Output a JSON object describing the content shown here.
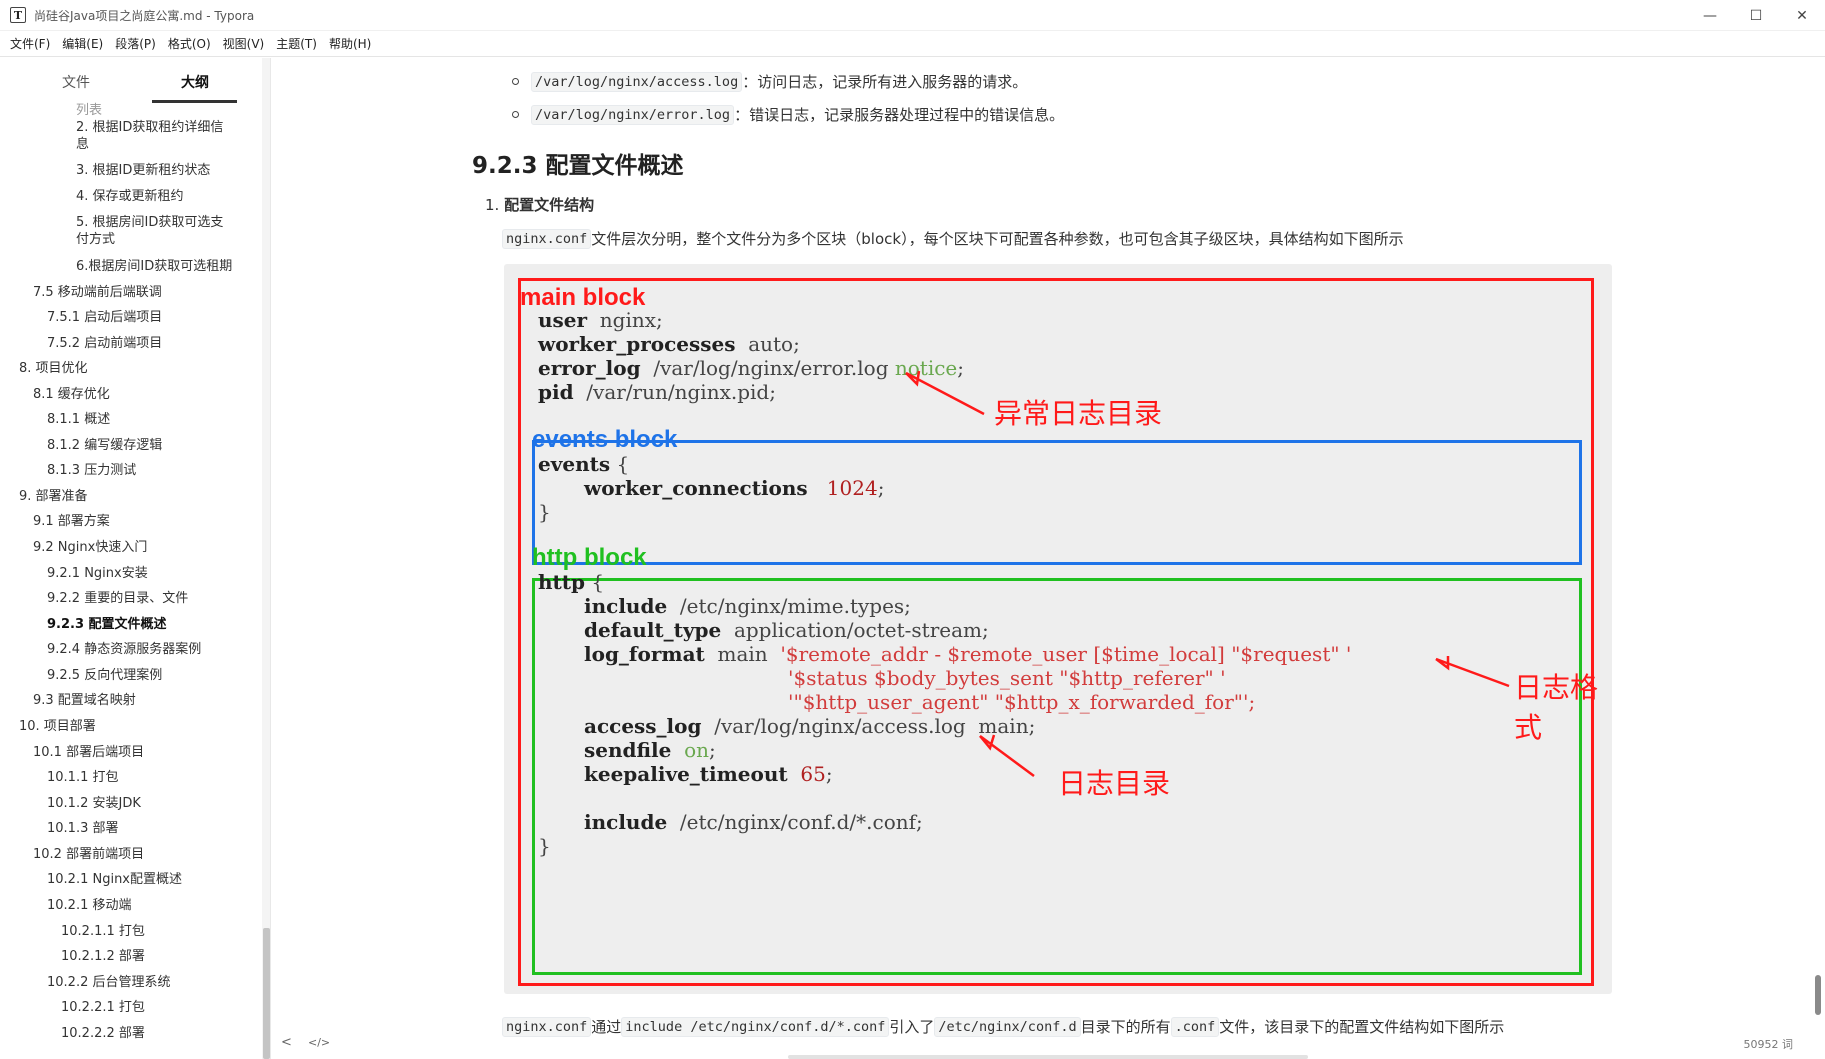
{
  "window": {
    "title": "尚硅谷Java项目之尚庭公寓.md - Typora",
    "app_icon": "T",
    "controls": [
      "minimize-icon",
      "maximize-icon",
      "close-icon"
    ]
  },
  "menu": [
    "文件(F)",
    "编辑(E)",
    "段落(P)",
    "格式(O)",
    "视图(V)",
    "主题(T)",
    "帮助(H)"
  ],
  "sidebar": {
    "tabs": [
      "文件",
      "大纲"
    ],
    "active_tab": "大纲",
    "outline": [
      "列表",
      "2. 根据ID获取租约详细信",
      "息",
      "3. 根据ID更新租约状态",
      "4. 保存或更新租约",
      "5. 根据房间ID获取可选支",
      "付方式",
      "6.根据房间ID获取可选租期",
      "7.5 移动端前后端联调",
      "7.5.1 启动后端项目",
      "7.5.2 启动前端项目",
      "8. 项目优化",
      "8.1 缓存优化",
      "8.1.1 概述",
      "8.1.2 编写缓存逻辑",
      "8.1.3 压力测试",
      "9. 部署准备",
      "9.1 部署方案",
      "9.2 Nginx快速入门",
      "9.2.1 Nginx安装",
      "9.2.2 重要的目录、文件",
      "9.2.3 配置文件概述",
      "9.2.4 静态资源服务器案例",
      "9.2.5 反向代理案例",
      "9.3 配置域名映射",
      "10. 项目部署",
      "10.1 部署后端项目",
      "10.1.1 打包",
      "10.1.2 安装JDK",
      "10.1.3 部署",
      "10.2 部署前端项目",
      "10.2.1 Nginx配置概述",
      "10.2.1 移动端",
      "10.2.1.1 打包",
      "10.2.1.2 部署",
      "10.2.2 后台管理系统",
      "10.2.2.1 打包",
      "10.2.2.2 部署"
    ],
    "active_item": "9.2.3 配置文件概述"
  },
  "content": {
    "bullets": [
      {
        "code": "/var/log/nginx/access.log",
        "text": "：访问日志，记录所有进入服务器的请求。"
      },
      {
        "code": "/var/log/nginx/error.log",
        "text": "：错误日志，记录服务器处理过程中的错误信息。"
      }
    ],
    "heading": "9.2.3 配置文件概述",
    "list_num": "1.",
    "list_title": "配置文件结构",
    "para1_code": "nginx.conf",
    "para1_text": "文件层次分明，整个文件分为多个区块（block），每个区块下可配置各种参数，也可包含其子级区块，具体结构如下图所示",
    "para2": {
      "c1": "nginx.conf",
      "t1": "通过",
      "c2": "include /etc/nginx/conf.d/*.conf",
      "t2": "引入了",
      "c3": "/etc/nginx/conf.d",
      "t3": "目录下的所有",
      "c4": ".conf",
      "t4": "文件，该目录下的配置文件结构如下图所示"
    }
  },
  "figure": {
    "main_label": "main block",
    "events_label": "events block",
    "http_label": "http block",
    "colors": {
      "main": "#ff1a1a",
      "events": "#1e73e8",
      "http": "#20c020"
    },
    "main": {
      "user_kw": "user",
      "user_val": "nginx;",
      "wp_kw": "worker_processes",
      "wp_val": "auto;",
      "el_kw": "error_log",
      "el_val": "/var/log/nginx/error.log",
      "el_level": "notice",
      "el_semi": ";",
      "pid_kw": "pid",
      "pid_val": "/var/run/nginx.pid;"
    },
    "events": {
      "kw": "events",
      "open": "{",
      "wc_kw": "worker_connections",
      "wc_val": "1024",
      "wc_semi": ";",
      "close": "}"
    },
    "http": {
      "kw": "http",
      "open": "{",
      "inc_kw": "include",
      "inc_val": "/etc/nginx/mime.types;",
      "dt_kw": "default_type",
      "dt_val": "application/octet-stream;",
      "lf_kw": "log_format",
      "lf_name": "main",
      "lf_1": "'$remote_addr - $remote_user [$time_local] \"$request\" '",
      "lf_2": "'$status $body_bytes_sent \"$http_referer\" '",
      "lf_3": "'\"$http_user_agent\" \"$http_x_forwarded_for\"';",
      "al_kw": "access_log",
      "al_val": "/var/log/nginx/access.log  main;",
      "sf_kw": "sendfile",
      "sf_val": "on",
      "sf_semi": ";",
      "ka_kw": "keepalive_timeout",
      "ka_val": "65",
      "ka_semi": ";",
      "inc2_kw": "include",
      "inc2_val": "/etc/nginx/conf.d/*.conf;",
      "close": "}"
    },
    "notes": {
      "error_log": "异常日志目录",
      "log_format": "日志格式",
      "access_log": "日志目录"
    }
  },
  "statusbar": {
    "back_icon": "<",
    "source_icon": "</>",
    "word_count": "50952 词"
  }
}
